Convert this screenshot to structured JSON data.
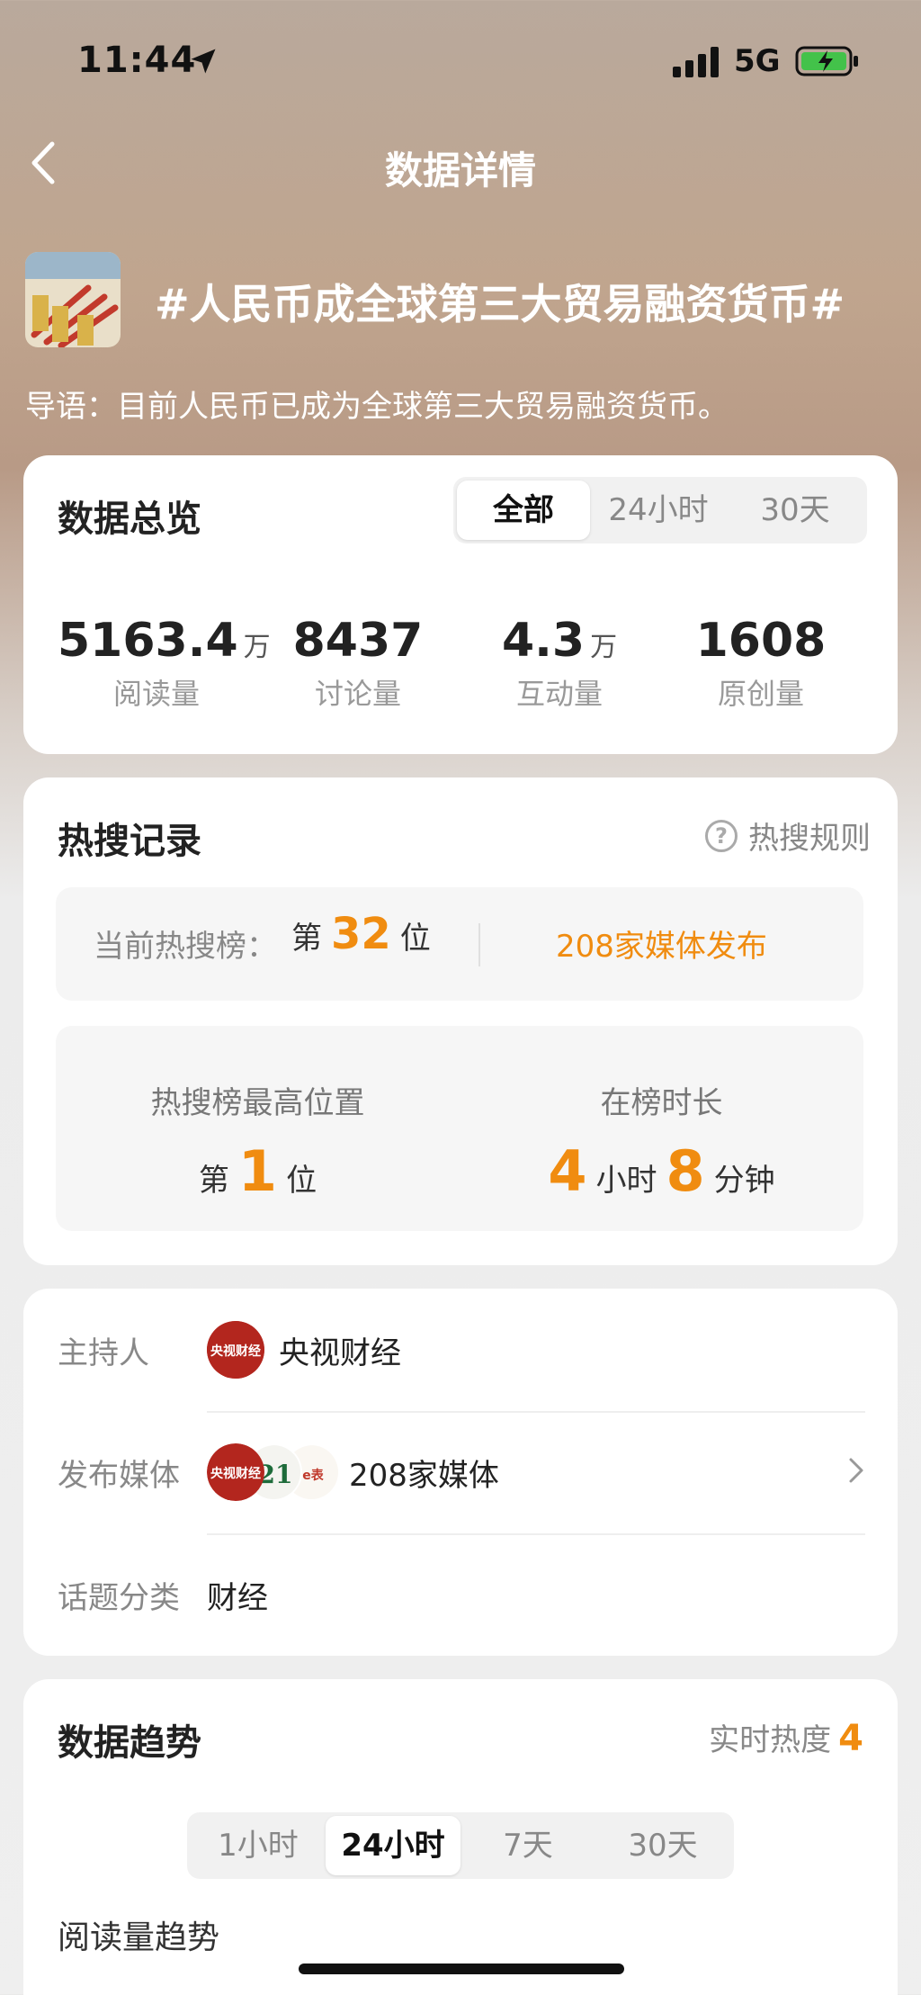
{
  "status_bar": {
    "time": "11:44",
    "network": "5G"
  },
  "nav": {
    "title": "数据详情"
  },
  "topic": {
    "title": "#人民币成全球第三大贸易融资货币#",
    "intro": "导语：目前人民币已成为全球第三大贸易融资货币。"
  },
  "overview": {
    "title": "数据总览",
    "tabs": [
      {
        "label": "全部",
        "active": true
      },
      {
        "label": "24小时"
      },
      {
        "label": "30天"
      }
    ],
    "stats": [
      {
        "value": "5163.4",
        "unit": "万",
        "label": "阅读量"
      },
      {
        "value": "8437",
        "unit": "",
        "label": "讨论量"
      },
      {
        "value": "4.3",
        "unit": "万",
        "label": "互动量"
      },
      {
        "value": "1608",
        "unit": "",
        "label": "原创量"
      }
    ]
  },
  "hot_search": {
    "title": "热搜记录",
    "rules_label": "热搜规则",
    "current_label": "当前热搜榜：",
    "rank_prefix": "第",
    "current_rank": "32",
    "rank_suffix": "位",
    "media_link": "208家媒体发布",
    "highest_label": "热搜榜最高位置",
    "highest_prefix": "第",
    "highest_rank": "1",
    "highest_suffix": "位",
    "duration_label": "在榜时长",
    "duration_hours": "4",
    "hours_unit": "小时",
    "duration_minutes": "8",
    "minutes_unit": "分钟"
  },
  "info": {
    "host_label": "主持人",
    "host_name": "央视财经",
    "media_label": "发布媒体",
    "media_count": "208家媒体",
    "category_label": "话题分类",
    "category_value": "财经",
    "avatar_text_cctv": "央视财经",
    "avatar_text_21": "21",
    "avatar_text_3": "e表"
  },
  "trend": {
    "title": "数据趋势",
    "heat_label": "实时热度",
    "heat_value": "4",
    "tabs": [
      {
        "label": "1小时"
      },
      {
        "label": "24小时",
        "active": true
      },
      {
        "label": "7天"
      },
      {
        "label": "30天"
      }
    ],
    "subtitle": "阅读量趋势"
  },
  "colors": {
    "accent": "#f08c10",
    "card": "#ffffff",
    "muted": "#888888"
  }
}
